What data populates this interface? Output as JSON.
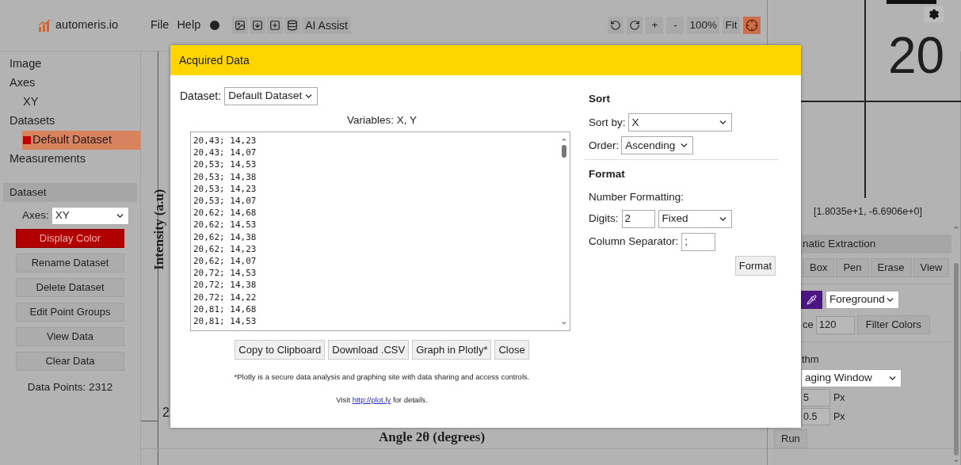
{
  "topbar": {
    "logo_text": "automeris.io",
    "menu": [
      "File",
      "Help"
    ],
    "ai_assist": "AI Assist",
    "zoom_controls": [
      "+",
      "-",
      "100%",
      "Fit"
    ],
    "crosshair_tool": {
      "selected": true
    }
  },
  "sidebar": {
    "tree": [
      {
        "label": "Image",
        "selected": false
      },
      {
        "label": "Axes",
        "selected": false,
        "children": [
          {
            "label": "XY",
            "selected": false
          }
        ]
      },
      {
        "label": "Datasets",
        "selected": false,
        "children": [
          {
            "label": "Default Dataset",
            "selected": true,
            "color": "#c00000"
          }
        ]
      },
      {
        "label": "Measurements",
        "selected": false
      }
    ]
  },
  "dataset_panel": {
    "title": "Dataset",
    "axes_label": "Axes:",
    "axes_value": "XY",
    "buttons": [
      {
        "label": "Display Color",
        "kind": "color",
        "color": "#b00000"
      },
      {
        "label": "Rename Dataset",
        "kind": "plain"
      },
      {
        "label": "Delete Dataset",
        "kind": "plain"
      },
      {
        "label": "Edit Point Groups",
        "kind": "plain"
      },
      {
        "label": "View Data",
        "kind": "plain"
      },
      {
        "label": "Clear Data",
        "kind": "plain"
      }
    ],
    "data_points": "Data Points: 2312"
  },
  "canvas": {
    "y_axis_label": "Intensity (a.u)",
    "x_tick": "2",
    "x_axis_label": "Angle 2θ (degrees)"
  },
  "right_panel": {
    "zoom_text": "20",
    "cursor_coords": "[1.8035e+1, -6.6906e+0]",
    "extraction_title": "natic Extraction",
    "tools": [
      "Box",
      "Pen",
      "Erase",
      "View"
    ],
    "mode_select": "Foreground",
    "distance_label": "ce",
    "distance_value": "120",
    "filter_button": "Filter Colors",
    "algorithm_label": "thm",
    "algorithm_select": "aging Window",
    "params": [
      {
        "value": "5",
        "unit": "Px"
      },
      {
        "value": "0.5",
        "unit": "Px"
      }
    ],
    "run_button": "Run"
  },
  "modal": {
    "title": "Acquired Data",
    "dataset_label": "Dataset:",
    "dataset_value": "Default Dataset",
    "variables": "Variables: X, Y",
    "rows": [
      "20,43; 14,23",
      "20,43; 14,07",
      "20,53; 14,53",
      "20,53; 14,38",
      "20,53; 14,23",
      "20,53; 14,07",
      "20,62; 14,68",
      "20,62; 14,53",
      "20,62; 14,38",
      "20,62; 14,23",
      "20,62; 14,07",
      "20,72; 14,53",
      "20,72; 14,38",
      "20,72; 14,22",
      "20,81; 14,68",
      "20,81; 14,53"
    ],
    "buttons": [
      "Copy to Clipboard",
      "Download .CSV",
      "Graph in Plotly*",
      "Close"
    ],
    "footnote": "*Plotly is a secure data analysis and graphing site with data sharing and access controls.",
    "visit": {
      "before": "Visit",
      "link": "http://plot.ly",
      "after": "for details."
    },
    "sort": {
      "heading": "Sort",
      "sort_by_label": "Sort by:",
      "sort_by": "X",
      "order_label": "Order:",
      "order": "Ascending"
    },
    "format": {
      "heading": "Format",
      "number_formatting": "Number Formatting:",
      "digits_label": "Digits:",
      "digits": "2",
      "mode": "Fixed",
      "separator_label": "Column Separator:",
      "separator": ";",
      "button": "Format"
    }
  }
}
